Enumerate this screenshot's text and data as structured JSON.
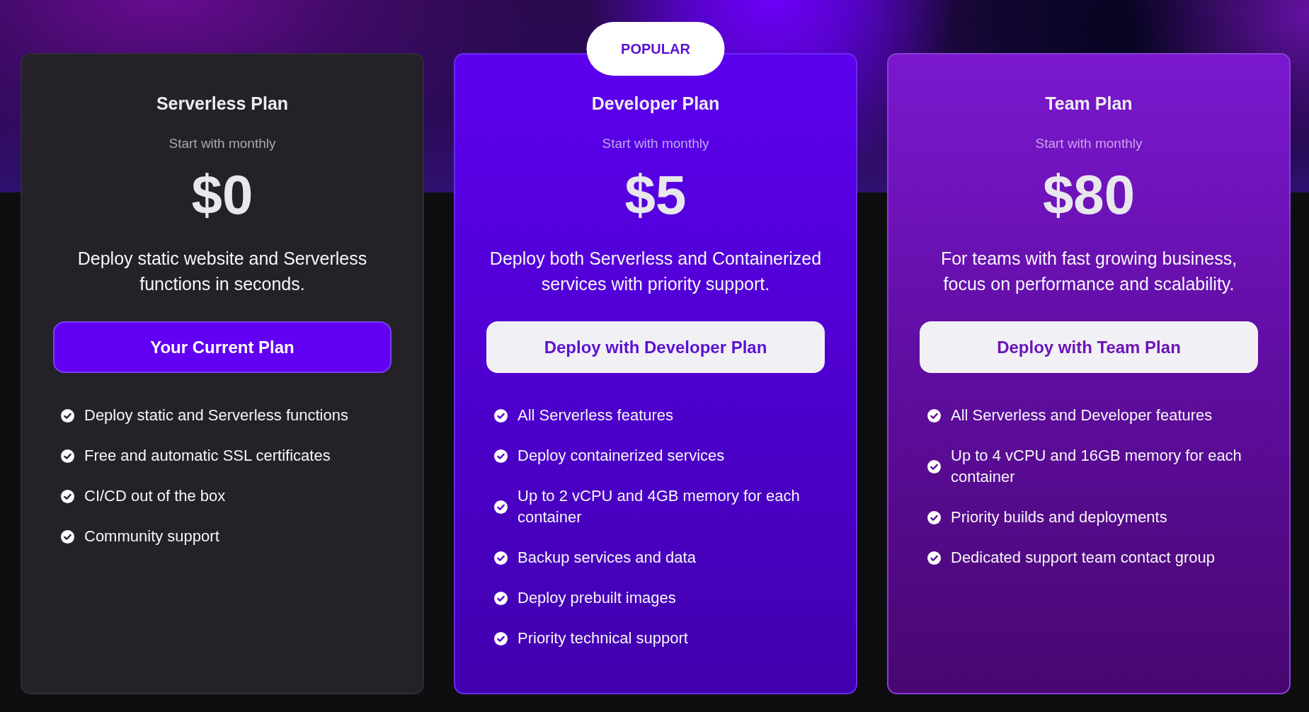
{
  "plans": [
    {
      "kind": "basic",
      "name": "Serverless Plan",
      "subtitle": "Start with monthly",
      "price": "$0",
      "description": "Deploy static website and Serverless functions in seconds.",
      "button": {
        "label": "Your Current Plan",
        "current": true
      },
      "features": [
        "Deploy static and Serverless functions",
        "Free and automatic SSL certificates",
        "CI/CD out of the box",
        "Community support"
      ]
    },
    {
      "kind": "popular",
      "badge": "POPULAR",
      "name": "Developer Plan",
      "subtitle": "Start with monthly",
      "price": "$5",
      "description": "Deploy both Serverless and Containerized services with priority support.",
      "button": {
        "label": "Deploy with Developer Plan",
        "current": false
      },
      "features": [
        "All Serverless features",
        "Deploy containerized services",
        "Up to 2 vCPU and 4GB memory for each container",
        "Backup services and data",
        "Deploy prebuilt images",
        "Priority technical support"
      ]
    },
    {
      "kind": "team",
      "name": "Team Plan",
      "subtitle": "Start with monthly",
      "price": "$80",
      "description": "For teams with fast growing business, focus on performance and scalability.",
      "button": {
        "label": "Deploy with Team Plan",
        "current": false
      },
      "features": [
        "All Serverless and Developer features",
        "Up to 4 vCPU and 16GB memory for each container",
        "Priority builds and deployments",
        "Dedicated support team contact group"
      ]
    }
  ]
}
